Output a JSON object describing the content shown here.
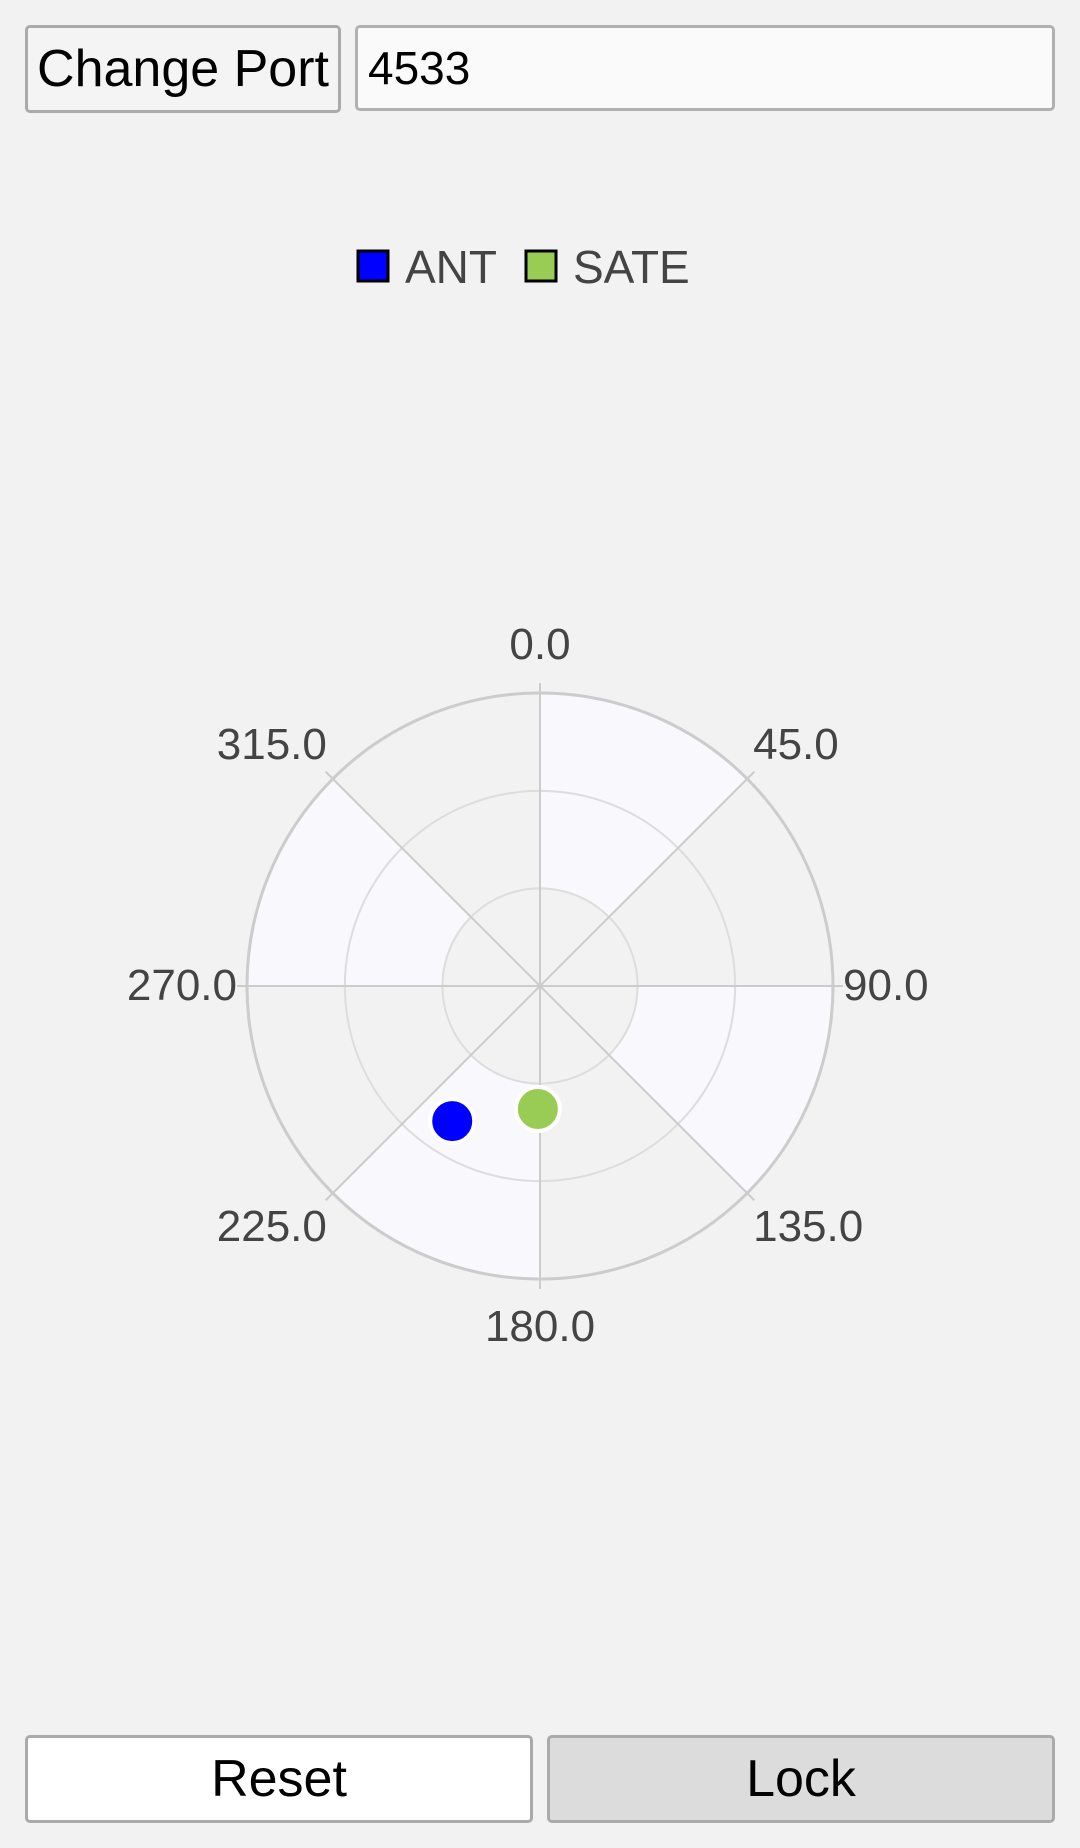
{
  "toolbar": {
    "change_port_label": "Change Port",
    "port_value": "4533"
  },
  "chart_data": {
    "type": "scatter",
    "subtype": "polar",
    "angle_ticks": [
      "0.0",
      "45.0",
      "90.0",
      "135.0",
      "180.0",
      "225.0",
      "270.0",
      "315.0"
    ],
    "legend_position": "top-center",
    "series": [
      {
        "name": "ANT",
        "color": "#0000ff",
        "points": [
          {
            "azimuth": 213,
            "radius": 0.55
          }
        ]
      },
      {
        "name": "SATE",
        "color": "#99cc55",
        "points": [
          {
            "azimuth": 181,
            "radius": 0.42
          }
        ]
      }
    ]
  },
  "footer": {
    "reset_label": "Reset",
    "lock_label": "Lock"
  }
}
